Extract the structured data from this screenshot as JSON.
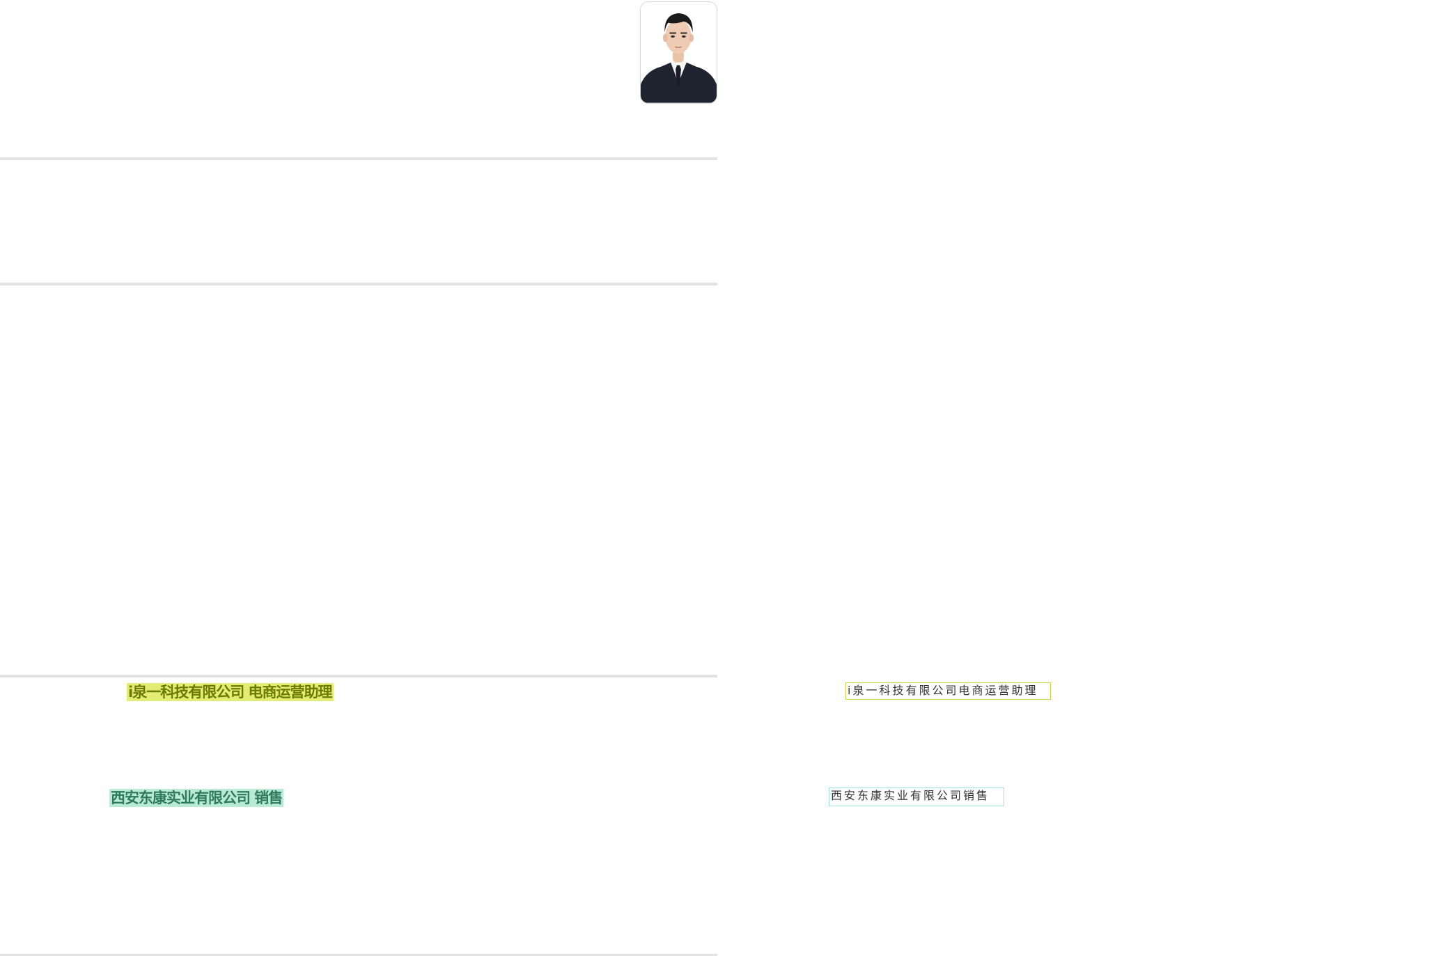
{
  "profile": {
    "photo_icon": "portrait-photo"
  },
  "experience": {
    "job1_highlight": "i泉一科技有限公司 电商运营助理",
    "job2_highlight": "西安东康实业有限公司 销售"
  },
  "annotations": {
    "job1_box": "i泉一科技有限公司电商运营助理",
    "job2_box": "西安东康实业有限公司销售"
  },
  "colors": {
    "rule": "#e2e2e2",
    "highlight_yellow": "#e3ec75",
    "highlight_teal": "#b9ead6",
    "box_yellow_border": "#c9d84a",
    "box_teal_border": "#9fe3e3"
  }
}
